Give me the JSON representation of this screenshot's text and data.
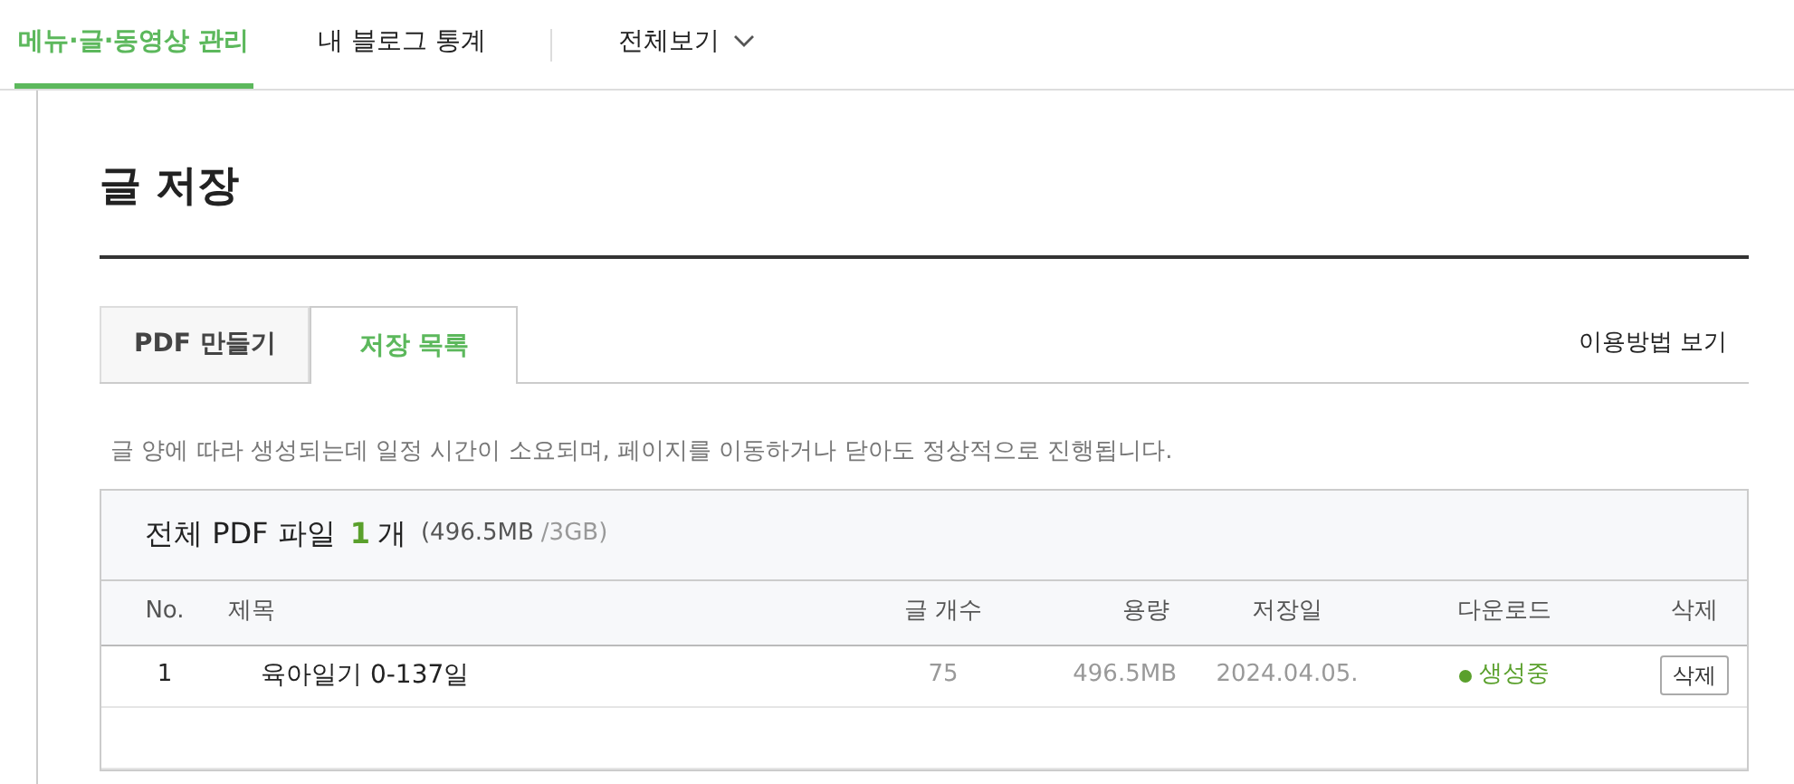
{
  "top_nav": {
    "items": [
      {
        "label": "메뉴·글·동영상 관리",
        "selected": true
      },
      {
        "label": "내 블로그 통계",
        "selected": false
      }
    ],
    "menu": {
      "label": "전체보기"
    }
  },
  "page_title": "글 저장",
  "tabs": [
    {
      "label": "PDF 만들기",
      "selected": false
    },
    {
      "label": "저장 목록",
      "selected": true
    }
  ],
  "help_link": "이용방법 보기",
  "notice": "글 양에 따라 생성되는데 일정 시간이 소요되며, 페이지를 이동하거나 닫아도 정상적으로 진행됩니다.",
  "summary": {
    "title": "전체 PDF 파일",
    "count": "1",
    "unit": "개",
    "size": "(496.5MB",
    "total": "/3GB)"
  },
  "table": {
    "columns": [
      "No.",
      "제목",
      "글 개수",
      "용량",
      "저장일",
      "다운로드",
      "삭제"
    ],
    "rows": [
      {
        "no": "1",
        "title": "육아일기 0-137일",
        "posts": "75",
        "size": "496.5MB",
        "date": "2024.04.05.",
        "status": {
          "label": "생성중",
          "color": "#5aa02c"
        },
        "delete": "삭제"
      }
    ]
  }
}
